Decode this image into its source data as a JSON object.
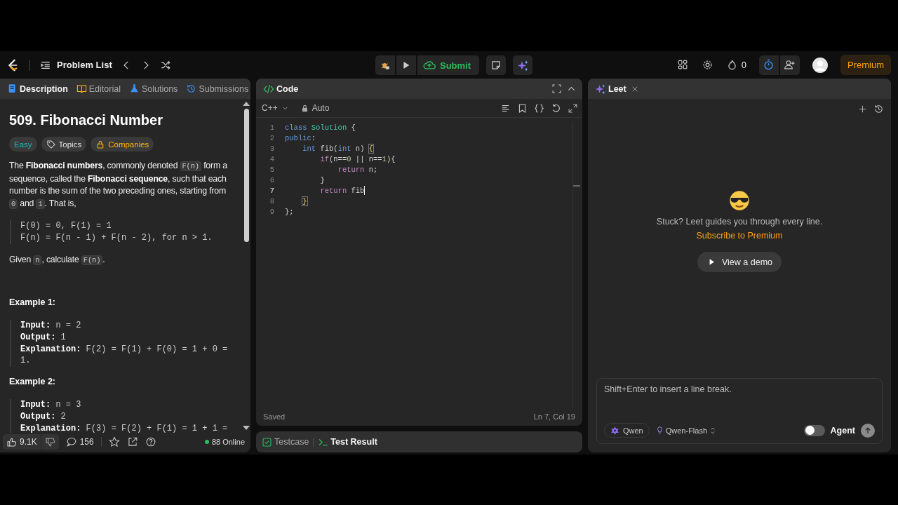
{
  "nav": {
    "problem_list": "Problem List",
    "submit": "Submit",
    "streak": "0",
    "premium": "Premium"
  },
  "description_panel": {
    "tabs": [
      {
        "label": "Description",
        "selected": true
      },
      {
        "label": "Editorial",
        "selected": false
      },
      {
        "label": "Solutions",
        "selected": false
      },
      {
        "label": "Submissions",
        "selected": false
      }
    ],
    "title": "509. Fibonacci Number",
    "tags": [
      {
        "label": "Easy",
        "kind": "difficulty"
      },
      {
        "label": "Topics",
        "kind": "topics"
      },
      {
        "label": "Companies",
        "kind": "companies"
      }
    ],
    "content": [
      {
        "kind": "paragraph",
        "parts": [
          {
            "kind": "text",
            "text": "The **Fibonacci numbers**, commonly denoted "
          },
          {
            "kind": "code",
            "text": "F(n)"
          },
          {
            "kind": "text",
            "text": " form a sequence, called the **Fibonacci sequence**, such that each number is the sum of the two preceding ones, starting from "
          },
          {
            "kind": "code",
            "text": "0"
          },
          {
            "kind": "text",
            "text": " and "
          },
          {
            "kind": "code",
            "text": "1"
          },
          {
            "kind": "text",
            "text": ". That is,"
          }
        ]
      },
      {
        "kind": "formula",
        "lines": [
          "F(0) = 0, F(1) = 1",
          "F(n) = F(n - 1) + F(n - 2), for n > 1."
        ]
      },
      {
        "kind": "paragraph",
        "parts": [
          {
            "kind": "text",
            "text": "Given "
          },
          {
            "kind": "code",
            "text": "n"
          },
          {
            "kind": "text",
            "text": ", calculate "
          },
          {
            "kind": "code",
            "text": "F(n)"
          },
          {
            "kind": "text",
            "text": "."
          }
        ]
      },
      {
        "kind": "heading",
        "text": "Example 1:"
      },
      {
        "kind": "example",
        "lines": [
          {
            "label": "Input:",
            "value": "n = 2"
          },
          {
            "label": "Output:",
            "value": "1"
          },
          {
            "label": "Explanation:",
            "value": "F(2) = F(1) + F(0) = 1 + 0 = 1."
          }
        ]
      },
      {
        "kind": "heading",
        "text": "Example 2:"
      },
      {
        "kind": "example",
        "lines": [
          {
            "label": "Input:",
            "value": "n = 3"
          },
          {
            "label": "Output:",
            "value": "2"
          },
          {
            "label": "Explanation:",
            "value": "F(3) = F(2) + F(1) = 1 + 1 ="
          }
        ]
      }
    ],
    "footer": {
      "likes": "9.1K",
      "comments": "156",
      "online": "88 Online"
    }
  },
  "code_panel": {
    "title": "Code",
    "language": "C++",
    "mode": "Auto",
    "lines": [
      {
        "number": "1",
        "current": false,
        "tokens": [
          {
            "kind": "keyword",
            "text": "class "
          },
          {
            "kind": "class",
            "text": "Solution"
          },
          {
            "kind": "plain",
            "text": " {"
          }
        ]
      },
      {
        "number": "2",
        "current": false,
        "tokens": [
          {
            "kind": "keyword",
            "text": "public"
          },
          {
            "kind": "plain",
            "text": ":"
          }
        ]
      },
      {
        "number": "3",
        "current": false,
        "tokens": [
          {
            "kind": "keyword",
            "text": "    int"
          },
          {
            "kind": "plain",
            "text": " fib("
          },
          {
            "kind": "keyword",
            "text": "int"
          },
          {
            "kind": "plain",
            "text": " n) "
          },
          {
            "kind": "bracket",
            "text": "{"
          }
        ]
      },
      {
        "number": "4",
        "current": false,
        "tokens": [
          {
            "kind": "control",
            "text": "        if"
          },
          {
            "kind": "plain",
            "text": "(n=="
          },
          {
            "kind": "number",
            "text": "0"
          },
          {
            "kind": "plain",
            "text": " || n=="
          },
          {
            "kind": "number",
            "text": "1"
          },
          {
            "kind": "plain",
            "text": "){"
          }
        ]
      },
      {
        "number": "5",
        "current": false,
        "tokens": [
          {
            "kind": "control",
            "text": "            return"
          },
          {
            "kind": "plain",
            "text": " n;"
          }
        ]
      },
      {
        "number": "6",
        "current": false,
        "tokens": [
          {
            "kind": "plain",
            "text": "        }"
          }
        ]
      },
      {
        "number": "7",
        "current": true,
        "tokens": [
          {
            "kind": "control",
            "text": "        return"
          },
          {
            "kind": "plain",
            "text": " fib"
          }
        ]
      },
      {
        "number": "8",
        "current": false,
        "tokens": [
          {
            "kind": "bracket",
            "text": "    }"
          }
        ]
      },
      {
        "number": "9",
        "current": false,
        "tokens": [
          {
            "kind": "plain",
            "text": "};"
          }
        ]
      }
    ],
    "status": "Saved",
    "cursor_position": "Ln 7, Col 19"
  },
  "result_tabs": [
    {
      "label": "Testcase",
      "selected": false
    },
    {
      "label": "Test Result",
      "selected": true
    }
  ],
  "assistant": {
    "title": "Leet",
    "message": "Stuck? Leet guides you through every line.",
    "link": "Subscribe to Premium",
    "demo_button": "View a demo",
    "input": {
      "placeholder": "Shift+Enter to insert a line break."
    },
    "provider": "Qwen",
    "model": "Qwen-Flash",
    "agent": {
      "label": "Agent",
      "on": false
    }
  }
}
